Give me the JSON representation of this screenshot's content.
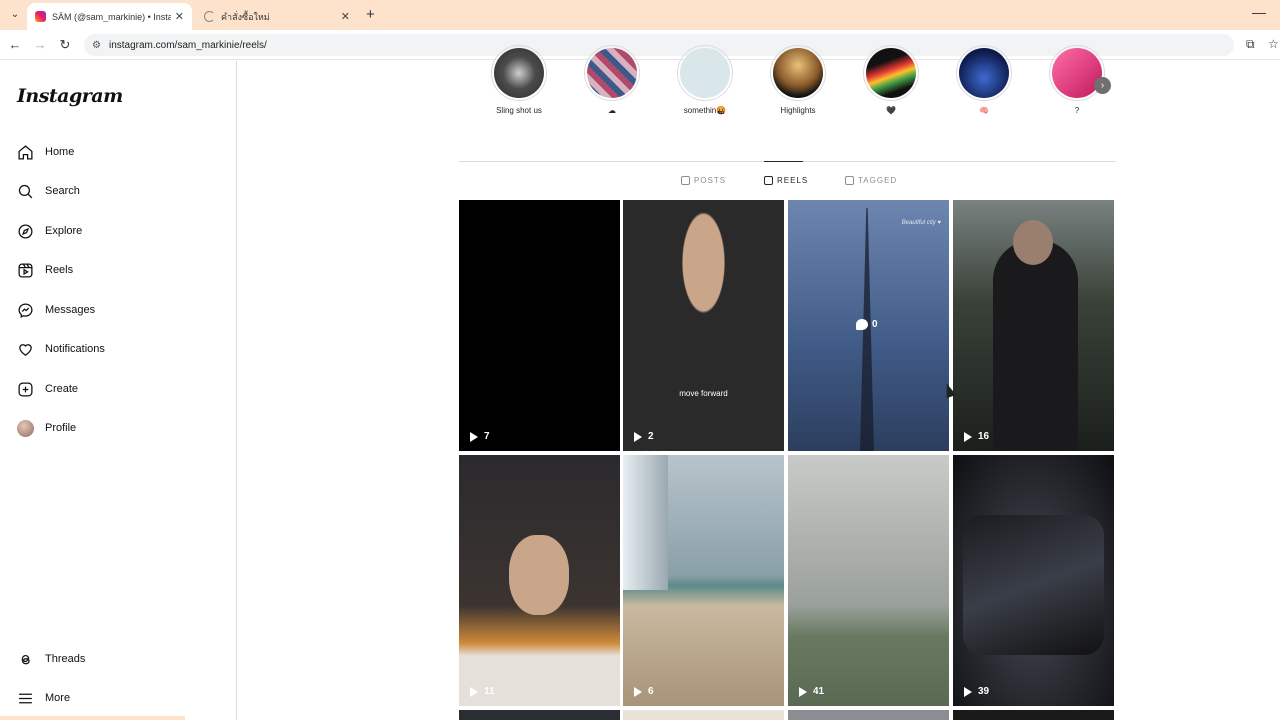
{
  "browser": {
    "tabs": [
      {
        "title": "SÄM (@sam_markinie) • Instagram",
        "active": true
      },
      {
        "title": "คำสั่งซื้อใหม่",
        "active": false
      }
    ],
    "new_tab": "+",
    "url": "instagram.com/sam_markinie/reels/"
  },
  "sidebar": {
    "logo": "Instagram",
    "items": [
      {
        "label": "Home",
        "icon": "home-icon"
      },
      {
        "label": "Search",
        "icon": "search-icon"
      },
      {
        "label": "Explore",
        "icon": "compass-icon"
      },
      {
        "label": "Reels",
        "icon": "reels-icon"
      },
      {
        "label": "Messages",
        "icon": "messenger-icon"
      },
      {
        "label": "Notifications",
        "icon": "heart-icon"
      },
      {
        "label": "Create",
        "icon": "plus-square-icon"
      },
      {
        "label": "Profile",
        "icon": "avatar"
      }
    ],
    "bottom_items": [
      {
        "label": "Threads",
        "icon": "threads-icon"
      },
      {
        "label": "More",
        "icon": "menu-icon"
      }
    ]
  },
  "highlights": [
    {
      "label": "Sling shot us",
      "color": "#6a6a6a"
    },
    {
      "label": "☁",
      "color": "#b04a6a"
    },
    {
      "label": "somethin🤬",
      "color": "#d9e6ea"
    },
    {
      "label": "Highlights",
      "color": "#c9a15a"
    },
    {
      "label": "🖤",
      "color": "#1e2a1e"
    },
    {
      "label": "🧠",
      "color": "#1a2a6a"
    },
    {
      "label": "?",
      "color": "#e8508a"
    }
  ],
  "profile_tabs": [
    {
      "label": "POSTS",
      "active": false
    },
    {
      "label": "REELS",
      "active": true
    },
    {
      "label": "TAGGED",
      "active": false
    }
  ],
  "reels": [
    {
      "views": "7",
      "bg": "#000000"
    },
    {
      "views": "2",
      "bg": "#2b2a2a",
      "caption": "move forward"
    },
    {
      "views": "",
      "bg": "#3f5a86",
      "comments": "0",
      "watermark": "Beautiful city ♥"
    },
    {
      "views": "16",
      "bg": "#3a4238"
    },
    {
      "views": "11",
      "bg": "#3b3430"
    },
    {
      "views": "6",
      "bg": "#8aa0a8"
    },
    {
      "views": "41",
      "bg": "#9aa09a"
    },
    {
      "views": "39",
      "bg": "#2a2d33"
    }
  ]
}
